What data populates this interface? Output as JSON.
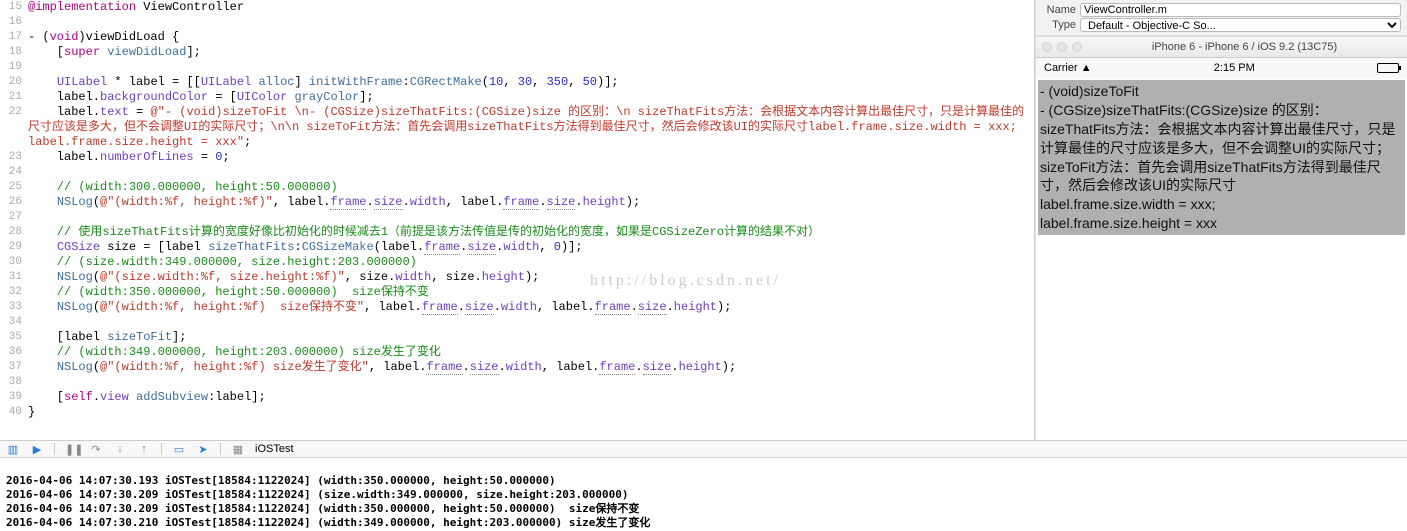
{
  "inspector": {
    "name_label": "Name",
    "name_value": "ViewController.m",
    "type_label": "Type",
    "type_value": "Default - Objective-C So..."
  },
  "simulator": {
    "title": "iPhone 6 - iPhone 6 / iOS 9.2 (13C75)",
    "carrier": "Carrier",
    "time": "2:15 PM"
  },
  "label_content": {
    "l1": "- (void)sizeToFit",
    "l2": "- (CGSize)sizeThatFits:(CGSize)size 的区别：",
    "l3": " sizeThatFits方法：会根据文本内容计算出最佳尺寸，只是计算最佳的尺寸应该是多大，但不会调整UI的实际尺寸；",
    "l4": "",
    "l5": " sizeToFit方法：首先会调用sizeThatFits方法得到最佳尺寸，然后会修改该UI的实际尺寸",
    "l6": "label.frame.size.width = xxx;",
    "l7": "label.frame.size.height = xxx"
  },
  "watermark": "http://blog.csdn.net/",
  "toolbar": {
    "target": "iOSTest"
  },
  "code_lines": {
    "15": {
      "a": "@implementation",
      "b": " ViewController"
    },
    "17": {
      "a": "- (",
      "b": "void",
      "c": ")viewDidLoad {"
    },
    "18": {
      "a": "    [",
      "b": "super",
      "c": " ",
      "d": "viewDidLoad",
      "e": "];"
    },
    "20": {
      "a": "    ",
      "b": "UILabel",
      "c": " * label = [[",
      "d": "UILabel",
      "e": " ",
      "f": "alloc",
      "g": "] ",
      "h": "initWithFrame",
      "i": ":",
      "j": "CGRectMake",
      "k": "(",
      "n1": "10",
      "c2": ", ",
      "n2": "30",
      "c3": ", ",
      "n3": "350",
      "c4": ", ",
      "n4": "50",
      "l": ")];"
    },
    "21": {
      "a": "    label.",
      "b": "backgroundColor",
      "c": " = [",
      "d": "UIColor",
      "e": " ",
      "f": "grayColor",
      "g": "];"
    },
    "22": {
      "a": "    label.",
      "b": "text",
      "c": " = ",
      "s": "@\"- (void)sizeToFit \\n- (CGSize)sizeThatFits:(CGSize)size 的区别：\\n sizeThatFits方法：会根据文本内容计算出最佳尺寸，只是计算最佳的尺寸应该是多大，但不会调整UI的实际尺寸；\\n\\n sizeToFit方法：首先会调用sizeThatFits方法得到最佳尺寸，然后会修改该UI的实际尺寸label.frame.size.width = xxx; label.frame.size.height = xxx\"",
      "d": ";"
    },
    "23": {
      "a": "    label.",
      "b": "numberOfLines",
      "c": " = ",
      "n": "0",
      "d": ";"
    },
    "25": {
      "c": "    // (width:300.000000, height:50.000000)"
    },
    "26": {
      "a": "    ",
      "b": "NSLog",
      "c": "(",
      "s": "@\"(width:%f, height:%f)\"",
      "d": ", label.",
      "e": "frame",
      "f": ".",
      "g": "size",
      "h": ".",
      "i": "width",
      "j": ", label.",
      "k": "frame",
      "l": ".",
      "m": "size",
      "n": ".",
      "o": "height",
      "p": ");"
    },
    "28": {
      "c": "    // 使用sizeThatFits计算的宽度好像比初始化的时候减去1（前提是该方法传值是传的初始化的宽度，如果是CGSizeZero计算的结果不对）"
    },
    "29": {
      "a": "    ",
      "b": "CGSize",
      "c": " size = [label ",
      "d": "sizeThatFits",
      "e": ":",
      "f": "CGSizeMake",
      "g": "(label.",
      "h": "frame",
      "i": ".",
      "j": "size",
      "k": ".",
      "l": "width",
      "m": "、",
      "w": "width",
      "n": ", ",
      "num": "0",
      "o": ")];"
    },
    "30": {
      "c": "    // (size.width:349.000000, size.height:203.000000)"
    },
    "31": {
      "a": "    ",
      "b": "NSLog",
      "c": "(",
      "s": "@\"(size.width:%f, size.height:%f)\"",
      "d": ", size.",
      "e": "width",
      "f": ", size.",
      "g": "height",
      "h": ");"
    },
    "32": {
      "c": "    // (width:350.000000, height:50.000000)  size保持不变"
    },
    "33": {
      "a": "    ",
      "b": "NSLog",
      "c": "(",
      "s": "@\"(width:%f, height:%f)  size保持不变\"",
      "d": ", label.",
      "e": "frame",
      "f": ".",
      "g": "size",
      "h": ".",
      "i": "width",
      "j": ", label.",
      "k": "frame",
      "l": ".",
      "m": "size",
      "n": ".",
      "o": "height",
      "p": ");"
    },
    "35": {
      "a": "    [label ",
      "b": "sizeToFit",
      "c": "];"
    },
    "36": {
      "c": "    // (width:349.000000, height:203.000000) size发生了变化"
    },
    "37": {
      "a": "    ",
      "b": "NSLog",
      "c": "(",
      "s": "@\"(width:%f, height:%f) size发生了变化\"",
      "d": ", label.",
      "e": "frame",
      "f": ".",
      "g": "size",
      "h": ".",
      "i": "width",
      "j": ", label.",
      "k": "frame",
      "l": ".",
      "m": "size",
      "n": ".",
      "o": "height",
      "p": ");"
    },
    "39": {
      "a": "    [",
      "b": "self",
      "c": ".",
      "d": "view",
      "e": " ",
      "f": "addSubview",
      "g": ":label];"
    },
    "40": {
      "a": "}"
    }
  },
  "console": {
    "l1": "2016-04-06 14:07:30.193 iOSTest[18584:1122024] (width:350.000000, height:50.000000)",
    "l2": "2016-04-06 14:07:30.209 iOSTest[18584:1122024] (size.width:349.000000, size.height:203.000000)",
    "l3": "2016-04-06 14:07:30.209 iOSTest[18584:1122024] (width:350.000000, height:50.000000)  size保持不变",
    "l4": "2016-04-06 14:07:30.210 iOSTest[18584:1122024] (width:349.000000, height:203.000000) size发生了变化"
  }
}
